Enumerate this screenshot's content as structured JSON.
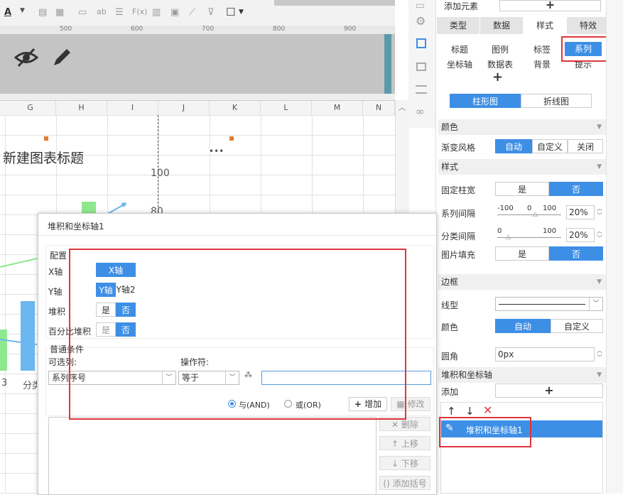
{
  "toolbar": {
    "font_letter": "A",
    "icons": [
      "font-color-icon",
      "border-icon",
      "table-icon",
      "link-icon",
      "text-icon",
      "align-icon",
      "formula-icon",
      "bar-chart-icon",
      "image-icon",
      "brush-icon",
      "border-box-icon"
    ]
  },
  "ruler": {
    "marks": [
      "500",
      "600",
      "700",
      "800",
      "900"
    ]
  },
  "grid": {
    "columns": [
      "G",
      "H",
      "I",
      "J",
      "K",
      "L",
      "M",
      "N"
    ]
  },
  "chart": {
    "title": "新建图表标题",
    "axis_ticks": [
      "100",
      "80"
    ],
    "more": "•••",
    "category_partial": "3",
    "category_partial2": "分类"
  },
  "panel": {
    "add_element_label": "添加元素",
    "add_symbol": "+",
    "tabs": [
      "类型",
      "数据",
      "样式",
      "特效"
    ],
    "active_tab": "样式",
    "subtabs_row1": [
      "标题",
      "图例",
      "标签",
      "系列"
    ],
    "subtabs_row2": [
      "坐标轴",
      "数据表",
      "背景",
      "提示"
    ],
    "active_subtab": "系列",
    "chart_types": [
      "柱形图",
      "折线图"
    ],
    "active_chart_type": "柱形图",
    "section_color": "颜色",
    "gradient_label": "渐变风格",
    "gradient_options": [
      "自动",
      "自定义",
      "关闭"
    ],
    "section_style": "样式",
    "fixed_width_label": "固定柱宽",
    "yes": "是",
    "no": "否",
    "series_gap_label": "系列间隔",
    "series_gap_scale": [
      "-100",
      "0",
      "100"
    ],
    "series_gap_value": "20%",
    "category_gap_label": "分类间隔",
    "category_gap_scale": [
      "0",
      "100"
    ],
    "category_gap_value": "20%",
    "image_fill_label": "图片填充",
    "section_border": "边框",
    "line_type_label": "线型",
    "border_color_label": "颜色",
    "border_color_options": [
      "自动",
      "自定义"
    ],
    "radius_label": "圆角",
    "radius_value": "0px",
    "section_stack": "堆积和坐标轴",
    "add_label": "添加",
    "stack_item": "堆积和坐标轴1"
  },
  "dialog": {
    "title": "堆积和坐标轴1",
    "config_label": "配置",
    "x_axis_label": "X轴",
    "x_axis_value": "X轴",
    "y_axis_label": "Y轴",
    "y_axis_options": [
      "Y轴",
      "Y轴2"
    ],
    "stack_label": "堆积",
    "percent_stack_label": "百分比堆积",
    "yes": "是",
    "no": "否",
    "condition_label": "普通条件",
    "column_label": "可选列:",
    "operator_label": "操作符:",
    "column_value": "系列序号",
    "operator_value": "等于",
    "and_label": "与(AND)",
    "or_label": "或(OR)",
    "add_button": "增加",
    "modify_button": "修改",
    "delete_button": "删除",
    "up_button": "上移",
    "down_button": "下移",
    "bracket_button": "添加括号"
  }
}
